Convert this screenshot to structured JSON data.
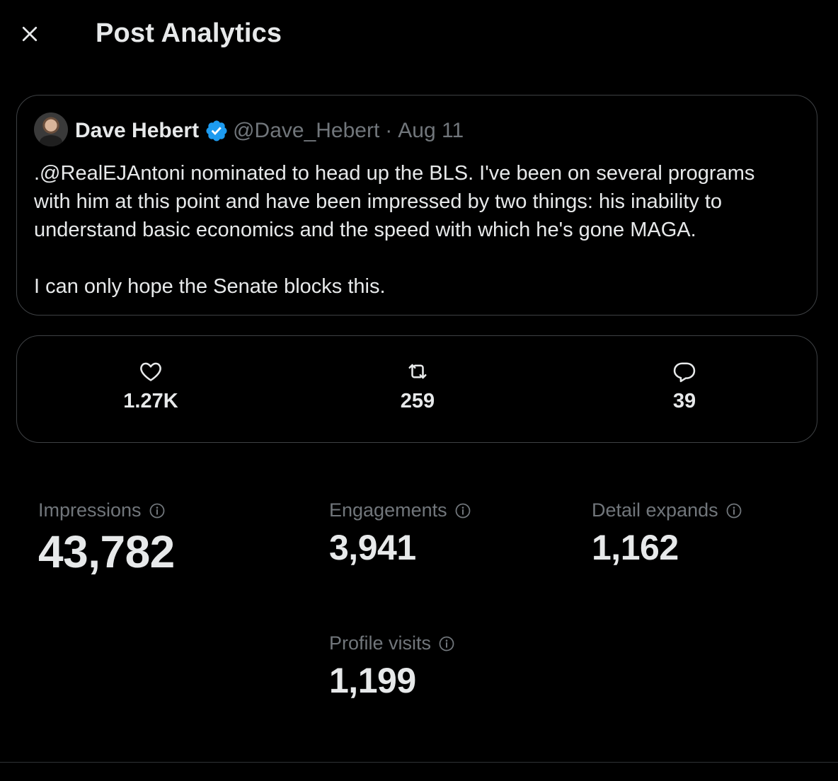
{
  "header": {
    "title": "Post Analytics"
  },
  "post": {
    "author_name": "Dave Hebert",
    "handle": "@Dave_Hebert",
    "separator": "·",
    "date": "Aug 11",
    "text": ".@RealEJAntoni nominated to head up the BLS. I've been on several programs\nwith him at this point and have been impressed by two things: his inability to\nunderstand basic economics and the speed with which he's gone MAGA.\n\nI can only hope the Senate blocks this."
  },
  "engagement_stats": {
    "likes": "1.27K",
    "reposts": "259",
    "replies": "39"
  },
  "metrics": {
    "impressions": {
      "label": "Impressions",
      "value": "43,782"
    },
    "engagements": {
      "label": "Engagements",
      "value": "3,941"
    },
    "detail_expands": {
      "label": "Detail expands",
      "value": "1,162"
    },
    "profile_visits": {
      "label": "Profile visits",
      "value": "1,199"
    }
  },
  "colors": {
    "background": "#000000",
    "text_primary": "#e7e9ea",
    "text_secondary": "#71767b",
    "border": "#3e4144",
    "verified_blue": "#1d9bf0"
  },
  "icons": {
    "close": "close-icon",
    "verified": "verified-badge-icon",
    "like": "heart-icon",
    "repost": "repost-icon",
    "reply": "reply-icon",
    "info": "info-icon"
  }
}
